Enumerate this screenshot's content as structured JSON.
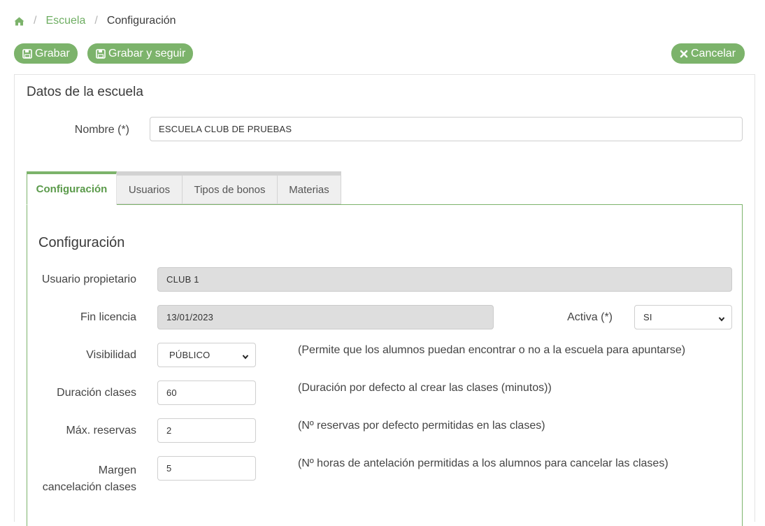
{
  "breadcrumb": {
    "home_icon": "home-icon",
    "items": [
      "Escuela",
      "Configuración"
    ]
  },
  "toolbar": {
    "grabar_label": "Grabar",
    "grabar_seguir_label": "Grabar y seguir",
    "cancelar_label": "Cancelar"
  },
  "colors": {
    "accent": "#7cb36b",
    "readonly_bg": "#dedede"
  },
  "school": {
    "title": "Datos de la escuela",
    "nombre_label": "Nombre (*)",
    "nombre_value": "ESCUELA CLUB DE PRUEBAS"
  },
  "tabs": [
    {
      "label": "Configuración",
      "active": true
    },
    {
      "label": "Usuarios",
      "active": false
    },
    {
      "label": "Tipos de bonos",
      "active": false
    },
    {
      "label": "Materias",
      "active": false
    }
  ],
  "config": {
    "title": "Configuración",
    "owner_label": "Usuario propietario",
    "owner_value": "CLUB 1",
    "license_label": "Fin licencia",
    "license_value": "13/01/2023",
    "active_label": "Activa (*)",
    "active_value": "SI",
    "visibility_label": "Visibilidad",
    "visibility_value": "PÚBLICO",
    "visibility_hint": "(Permite que los alumnos puedan encontrar o no a la escuela para apuntarse)",
    "duration_label": "Duración clases",
    "duration_value": "60",
    "duration_hint": "(Duración por defecto al crear las clases (minutos))",
    "max_label": "Máx. reservas",
    "max_value": "2",
    "max_hint": "(Nº reservas por defecto permitidas en las clases)",
    "margin_label_1": "Margen",
    "margin_label_2": "cancelación clases",
    "margin_value": "5",
    "margin_hint": "(Nº horas de antelación permitidas a los alumnos para cancelar las clases)"
  }
}
